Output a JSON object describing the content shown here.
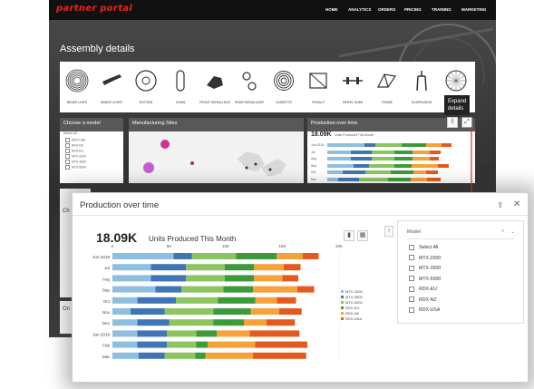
{
  "dashboard": {
    "logo": "partner portal",
    "nav": [
      "HOME",
      "ANALYTICS",
      "ORDERS",
      "PRICING",
      "TRAINING",
      "MARKETING"
    ],
    "hero_title": "Assembly details",
    "parts": [
      {
        "label": "BRAKE LINES",
        "icon": "coiled-cable-icon"
      },
      {
        "label": "BRAKE LEVER",
        "icon": "brake-lever-icon"
      },
      {
        "label": "ROTORS",
        "icon": "rotor-icon"
      },
      {
        "label": "CHAIN",
        "icon": "chain-icon"
      },
      {
        "label": "FRONT DERAILLEUR",
        "icon": "derailleur-icon"
      },
      {
        "label": "REAR DERAILLEUR",
        "icon": "rear-derailleur-icon"
      },
      {
        "label": "CASSETTE",
        "icon": "cassette-icon"
      },
      {
        "label": "PEDALS",
        "icon": "pedal-icon"
      },
      {
        "label": "WHEEL HUBS",
        "icon": "hub-icon"
      },
      {
        "label": "FRAME",
        "icon": "frame-icon"
      },
      {
        "label": "SUSPENSION",
        "icon": "fork-icon"
      },
      {
        "label": "",
        "icon": "wheel-icon"
      }
    ],
    "choose_model": {
      "title": "Choose a model",
      "subtitle": "Select all",
      "items": [
        "RDX-USA",
        "RDX-NZ",
        "RDX-EU",
        "MTX-2000",
        "MTX-3500",
        "MTX-5000"
      ]
    },
    "sites_title": "Manufacturing Sites",
    "mini_production": {
      "title": "Production over time",
      "value": "18.09K",
      "label": "Units Produced This Month",
      "rows": [
        "Jun 2018",
        "Jul",
        "Aug",
        "Sep",
        "Oct",
        "Nov"
      ]
    },
    "expand_tooltip": [
      "Expand",
      "details"
    ],
    "side_letters": [
      "Ch",
      "On"
    ]
  },
  "modal": {
    "title": "Production over time",
    "big_number": "18.09K",
    "big_label": "Units Produced This Month",
    "filter": {
      "label": "Model",
      "items": [
        "Select All",
        "MTX-2000",
        "MTX-3500",
        "MTX-5000",
        "RDX-EU",
        "RDX-NZ",
        "RDX-USA"
      ]
    }
  },
  "colors": {
    "MTX-2000": "#8fbfe0",
    "MTX-3500": "#3f74b5",
    "MTX-5000": "#8cc460",
    "RDX-EU": "#3c9a3a",
    "RDX-NZ": "#f5a23a",
    "RDX-USA": "#e35a1e"
  },
  "chart_data": {
    "type": "bar",
    "orientation": "horizontal",
    "stacked": true,
    "categories": [
      "Jun 2018",
      "Jul",
      "Aug",
      "Sep",
      "Oct",
      "Nov",
      "Dec",
      "Jan 2019",
      "Feb",
      "Mar"
    ],
    "xlim": [
      0,
      20000
    ],
    "x_ticks": [
      "0",
      "5K",
      "10K",
      "15K",
      "20K"
    ],
    "legend_position": "right",
    "series": [
      {
        "name": "MTX-2000",
        "values": [
          5400,
          3400,
          3400,
          3800,
          2200,
          1600,
          2200,
          2200,
          2200,
          2300
        ]
      },
      {
        "name": "MTX-3500",
        "values": [
          1600,
          3100,
          3100,
          2300,
          3400,
          3000,
          2800,
          2600,
          2600,
          2300
        ]
      },
      {
        "name": "MTX-5000",
        "values": [
          3900,
          3400,
          3400,
          3700,
          3700,
          4300,
          3900,
          2600,
          2600,
          2700
        ]
      },
      {
        "name": "RDX-EU",
        "values": [
          3600,
          2600,
          2600,
          2600,
          3300,
          3300,
          2700,
          1800,
          1000,
          900
        ]
      },
      {
        "name": "RDX-NZ",
        "values": [
          2300,
          2600,
          2500,
          3900,
          1900,
          2500,
          2000,
          2900,
          4200,
          4200
        ]
      },
      {
        "name": "RDX-USA",
        "values": [
          1400,
          1500,
          1400,
          1500,
          1700,
          2000,
          2500,
          4400,
          4600,
          4700
        ]
      }
    ]
  }
}
